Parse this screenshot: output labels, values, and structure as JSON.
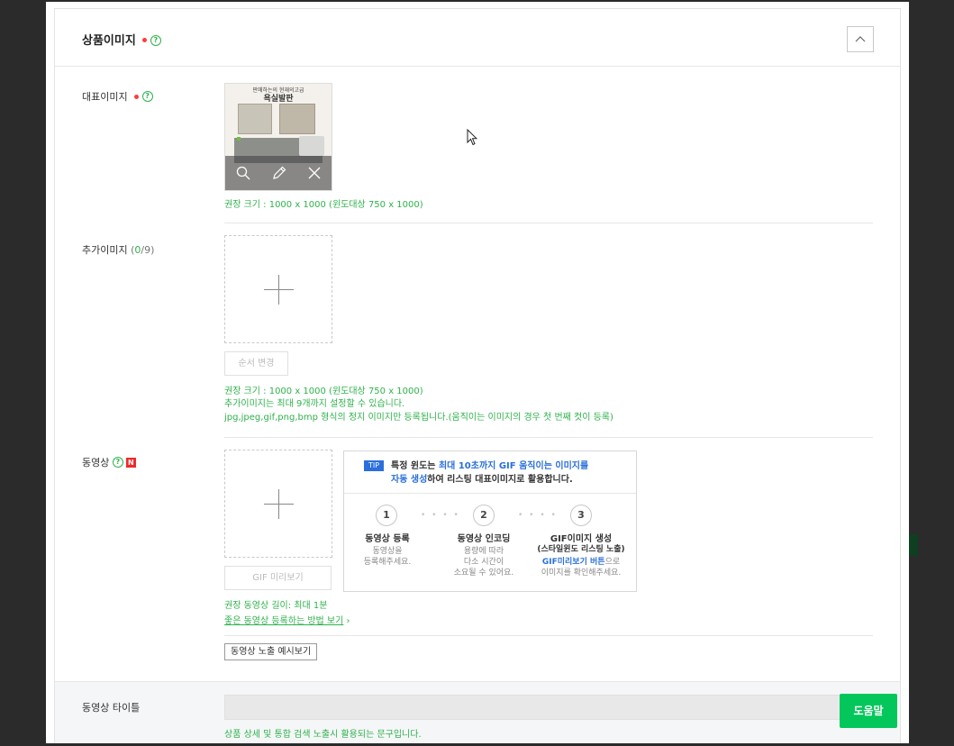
{
  "section": {
    "title": "상품이미지",
    "help": "?"
  },
  "rep_image": {
    "label": "대표이미지",
    "help": "?",
    "thumb_line1": "판매하는의 현재의고급",
    "thumb_line2": "욕실발판",
    "size_note": "권장 크기 : 1000 x 1000 (윈도대상 750 x 1000)"
  },
  "add_image": {
    "label": "추가이미지",
    "count_open": "(",
    "count_current": "0",
    "count_rest": "/9)",
    "order_button": "순서 변경",
    "note1": "권장 크기 : 1000 x 1000 (윈도대상 750 x 1000)",
    "note2": "추가이미지는 최대 9개까지 설정할 수 있습니다.",
    "note3": "jpg,jpeg,gif,png,bmp 형식의 정지 이미지만 등록됩니다.(움직이는 이미지의 경우 첫 번째 컷이 등록)"
  },
  "video": {
    "label": "동영상",
    "help": "?",
    "new_badge": "N",
    "gif_preview_button": "GIF 미리보기",
    "length_note": "권장 동영상 길이: 최대 1분",
    "howto_link": "좋은 동영상 등록하는 방법 보기",
    "howto_arrow": "›",
    "example_button": "동영상 노출 예시보기",
    "tip": {
      "badge": "TIP",
      "text_a": "특정 윈도는 ",
      "text_blue1": "최대 10초까지 GIF 움직이는 이미지를",
      "text_blue2": "자동 생성",
      "text_b": "하여 리스팅 대표이미지로 활용합니다.",
      "steps": [
        {
          "num": "1",
          "title": "동영상 등록",
          "sub1": "동영상을",
          "sub2": "등록해주세요.",
          "sub3": ""
        },
        {
          "num": "2",
          "title": "동영상 인코딩",
          "sub1": "용량에 따라",
          "sub2": "다소 시간이",
          "sub3": "소요될 수 있어요."
        },
        {
          "num": "3",
          "title": "GIF이미지 생성",
          "sub1": "(스타일윈도 리스팅 노출)",
          "sub2_blue": "GIF미리보기 버튼",
          "sub2_rest": "으로",
          "sub3": "이미지를 확인해주세요."
        }
      ],
      "dots": "• • • •"
    }
  },
  "video_title": {
    "label": "동영상 타이틀",
    "value": "",
    "note": "상품 상세 및 통합 검색 노출시 활용되는 문구입니다."
  },
  "help_fab": {
    "label": "도움말"
  },
  "colors": {
    "accent_green": "#2fb24c",
    "required_red": "#ff3c3c",
    "tip_blue": "#2a6fdb",
    "fab_green": "#03c75a"
  }
}
